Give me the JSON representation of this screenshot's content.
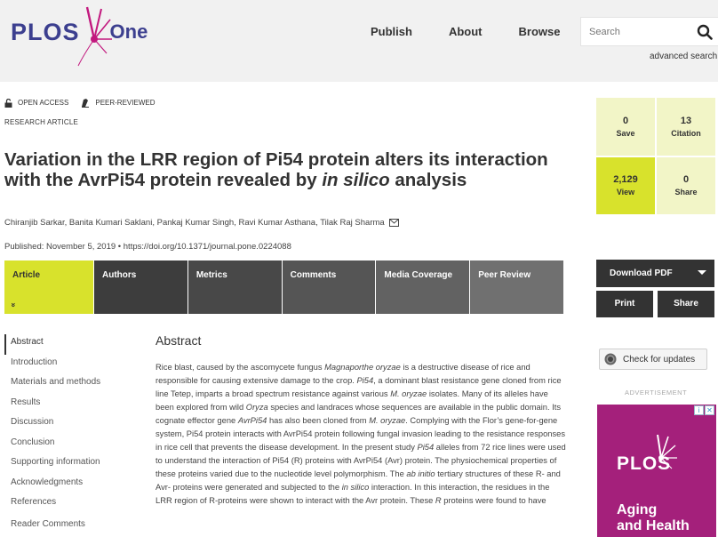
{
  "header": {
    "logo_text": "PLOS",
    "logo_suffix": "One",
    "nav": [
      "Publish",
      "About",
      "Browse"
    ],
    "search_placeholder": "Search",
    "advanced_search": "advanced search"
  },
  "badges": {
    "open_access": "OPEN ACCESS",
    "peer_reviewed": "PEER-REVIEWED"
  },
  "article": {
    "type": "RESEARCH ARTICLE",
    "title_part1": "Variation in the LRR region of Pi54 protein alters its interaction with the AvrPi54 protein revealed by ",
    "title_italic": "in silico",
    "title_part2": " analysis",
    "authors": "Chiranjib Sarkar,  Banita Kumari Saklani,  Pankaj Kumar Singh,  Ravi Kumar Asthana,  Tilak Raj Sharma",
    "published": "Published: November 5, 2019  •  https://doi.org/10.1371/journal.pone.0224088"
  },
  "tabs": [
    "Article",
    "Authors",
    "Metrics",
    "Comments",
    "Media Coverage",
    "Peer Review"
  ],
  "tab_chevron": "»",
  "leftnav": [
    "Abstract",
    "Introduction",
    "Materials and methods",
    "Results",
    "Discussion",
    "Conclusion",
    "Supporting information",
    "Acknowledgments",
    "References",
    "Reader Comments"
  ],
  "abstract": {
    "heading": "Abstract",
    "body_html": "Rice blast, caused by the ascomycete fungus <i>Magnaporthe oryzae</i> is a destructive disease of rice and responsible for causing extensive damage to the crop. <i>Pi54</i>, a dominant blast resistance gene cloned from rice line Tetep, imparts a broad spectrum resistance against various <i>M. oryzae</i> isolates. Many of its alleles have been explored from wild <i>Oryza</i> species and landraces whose sequences are available in the public domain. Its cognate effector gene <i>AvrPi54</i> has also been cloned from <i>M. oryzae</i>. Complying with the Flor’s gene-for-gene system, Pi54 protein interacts with AvrPi54 protein following fungal invasion leading to the resistance responses in rice cell that prevents the disease development. In the present study <i>Pi54</i> alleles from 72 rice lines were used to understand the interaction of Pi54 (R) proteins with AvrPi54 (Avr) protein. The physiochemical properties of these proteins varied due to the nucleotide level polymorphism. The <i>ab initio</i> tertiary structures of these R- and Avr- proteins were generated and subjected to the <i>in silico</i> interaction. In this interaction, the residues in the LRR region of R-proteins were shown to interact with the Avr protein. These <i>R</i> proteins were found to have"
  },
  "metrics": [
    {
      "num": "0",
      "label": "Save"
    },
    {
      "num": "13",
      "label": "Citation"
    },
    {
      "num": "2,129",
      "label": "View"
    },
    {
      "num": "0",
      "label": "Share"
    }
  ],
  "actions": {
    "download": "Download PDF",
    "print": "Print",
    "share": "Share",
    "check_updates": "Check for updates",
    "advertisement": "ADVERTISEMENT"
  },
  "ad": {
    "brand": "PLOS",
    "line1": "Aging",
    "line2": "and Health"
  },
  "colors": {
    "brand_navy": "#3c3f8f",
    "brand_magenta": "#c2187e",
    "accent_yellow": "#d8e22c",
    "metric_light": "#f2f5c7",
    "ad_bg": "#a4207b"
  }
}
